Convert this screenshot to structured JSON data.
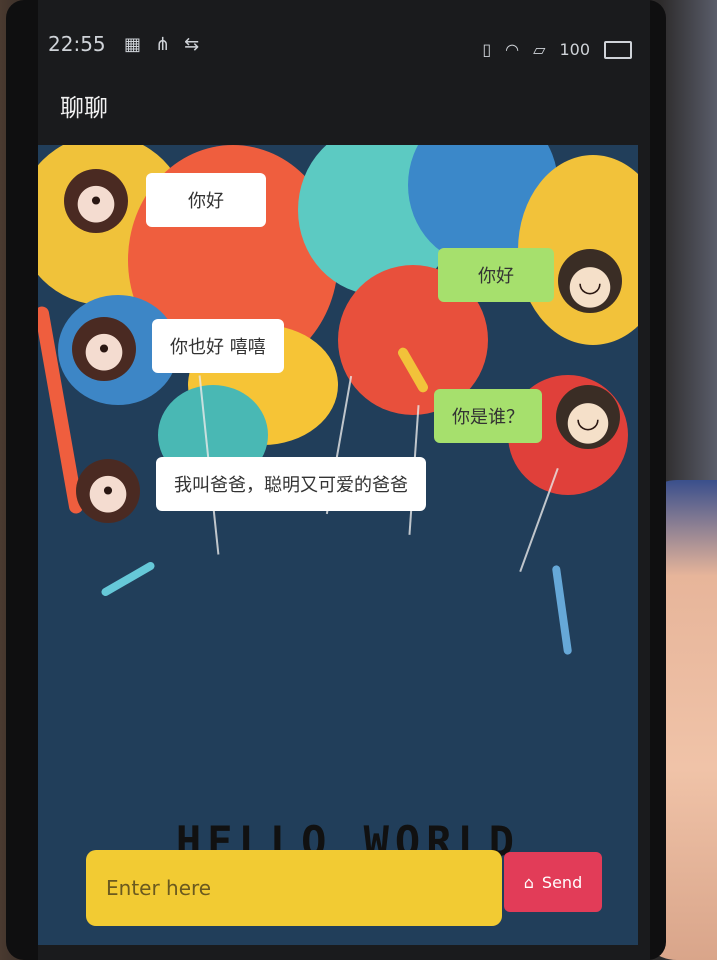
{
  "status_bar": {
    "time": "22:55",
    "battery": "100"
  },
  "app": {
    "title": "聊聊"
  },
  "messages": [
    {
      "side": "left",
      "text": "你好"
    },
    {
      "side": "right",
      "text": "你好"
    },
    {
      "side": "left",
      "text": "你也好 嘻嘻"
    },
    {
      "side": "right",
      "text": "你是谁？"
    },
    {
      "side": "left",
      "text": "我叫爸爸，聪明又可爱的爸爸"
    }
  ],
  "composer": {
    "placeholder": "Enter here",
    "send_label": "Send"
  },
  "icons": {
    "grid": "grid-icon",
    "share": "share-icon",
    "usb": "usb-icon",
    "vibrate": "vibrate-icon",
    "wifi": "wifi-icon",
    "sim": "sim-icon",
    "battery": "battery-icon",
    "send": "tag-icon"
  },
  "colors": {
    "background": "#213e5a",
    "input": "#f2cb33",
    "send": "#e23c58",
    "bubble_right": "#a6e06d",
    "bubble_left": "#ffffff"
  },
  "background_text": "HELLO WORLD"
}
